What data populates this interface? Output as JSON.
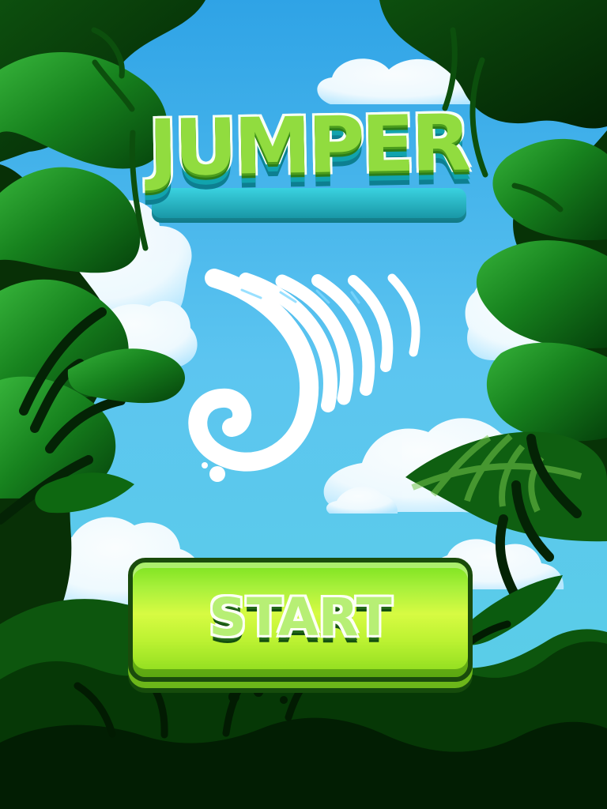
{
  "screen": {
    "name": "game-start-screen",
    "colors": {
      "sky_top": "#2fa3e6",
      "sky_bottom": "#4fcfe2",
      "jungle_dark": "#062d05",
      "jungle_green": "#2a9b27",
      "title_green": "#91dc3f",
      "title_outline": "#f8fff6",
      "button_green": "#c9f73b",
      "button_border": "#1a4b0c"
    }
  },
  "title": {
    "text": "JUMPER"
  },
  "start_button": {
    "label": "START"
  },
  "icons": {
    "foliage": "jungle-foliage-icon",
    "clouds": "cloud-icon",
    "whirl": "air-swirl-icon"
  }
}
